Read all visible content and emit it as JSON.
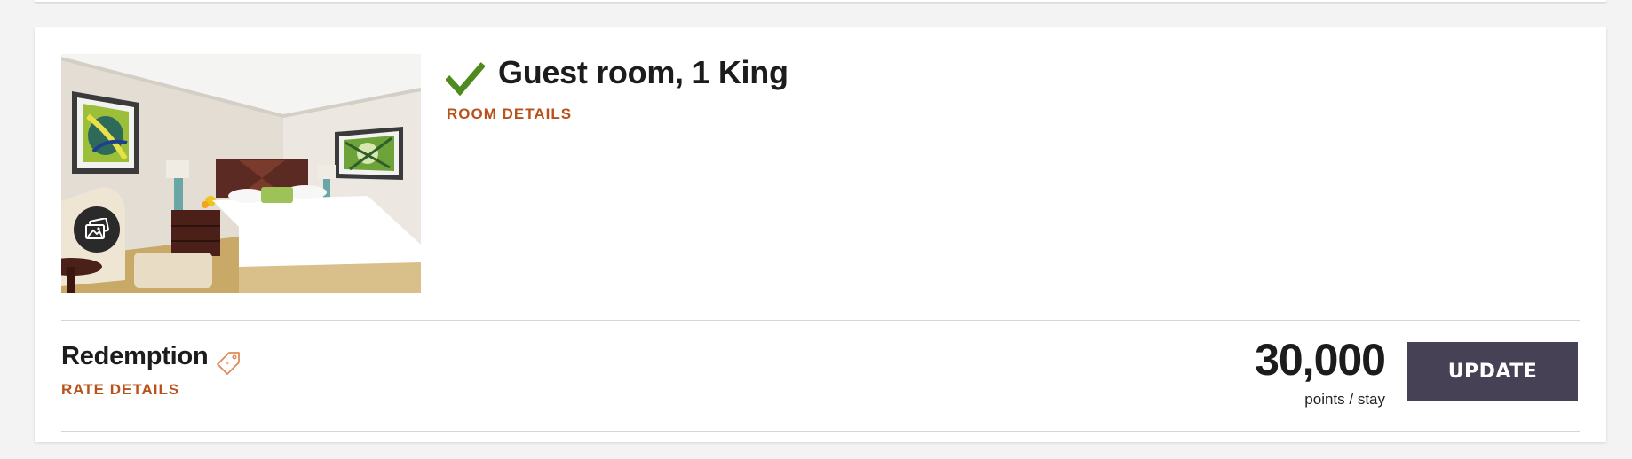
{
  "room": {
    "title": "Guest room, 1 King",
    "details_link": "ROOM DETAILS",
    "selected_icon": "checkmark-icon",
    "gallery_icon": "photo-gallery-icon",
    "photo_alt": "Guest room with king bed"
  },
  "rate": {
    "name": "Redemption",
    "details_link": "RATE DETAILS",
    "tag_icon": "price-tag-icon",
    "points": "30,000",
    "points_unit": "points / stay",
    "update_label": "UPDATE"
  },
  "colors": {
    "accent_link": "#b8511a",
    "check_green": "#4e8a1e",
    "button_bg": "#474156",
    "page_bg": "#f3f3f3",
    "card_bg": "#ffffff"
  }
}
